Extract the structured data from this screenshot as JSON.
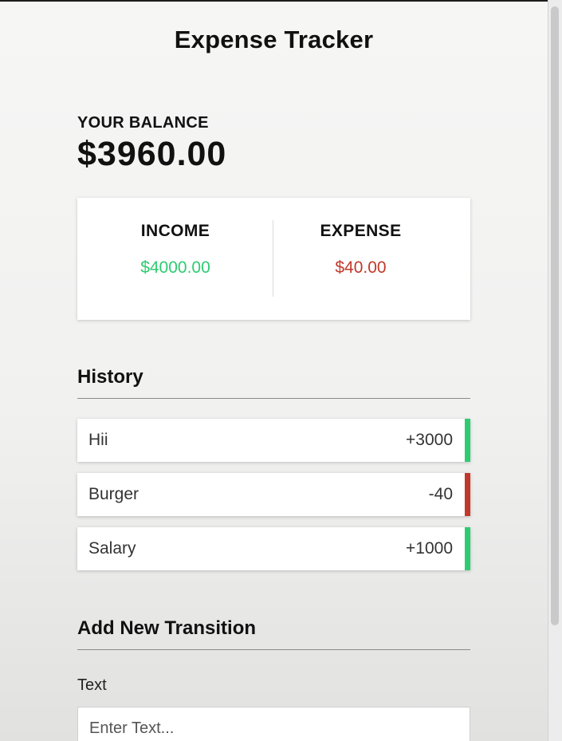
{
  "app": {
    "title": "Expense Tracker"
  },
  "balance": {
    "label": "YOUR BALANCE",
    "amount": "$3960.00"
  },
  "summary": {
    "income_label": "INCOME",
    "income_value": "$4000.00",
    "expense_label": "EXPENSE",
    "expense_value": "$40.00"
  },
  "history": {
    "heading": "History",
    "items": [
      {
        "text": "Hii",
        "amount": "+3000",
        "type": "income"
      },
      {
        "text": "Burger",
        "amount": "-40",
        "type": "expense"
      },
      {
        "text": "Salary",
        "amount": "+1000",
        "type": "income"
      }
    ]
  },
  "add_form": {
    "heading": "Add New Transition",
    "text_label": "Text",
    "text_placeholder": "Enter Text..."
  },
  "colors": {
    "income": "#2ecc71",
    "expense": "#c0392b"
  }
}
